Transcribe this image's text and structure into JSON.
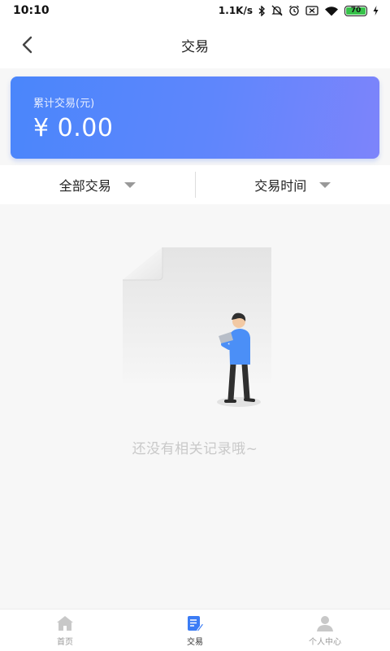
{
  "status_bar": {
    "time": "10:10",
    "network_speed": "1.1K/s",
    "battery_level": "70",
    "icons": [
      "bluetooth-icon",
      "mute-icon",
      "alarm-icon",
      "sim-icon",
      "wifi-icon",
      "battery-icon",
      "charging-icon"
    ]
  },
  "nav": {
    "title": "交易",
    "back_icon": "chevron-left-icon"
  },
  "summary": {
    "label": "累计交易(元)",
    "value": "¥ 0.00"
  },
  "filters": [
    {
      "label": "全部交易",
      "icon": "caret-down-icon"
    },
    {
      "label": "交易时间",
      "icon": "caret-down-icon"
    }
  ],
  "empty_state": {
    "message": "还没有相关记录哦~",
    "illustration": "empty-document-illustration"
  },
  "tab_bar": {
    "items": [
      {
        "label": "首页",
        "icon": "home-icon",
        "active": false
      },
      {
        "label": "交易",
        "icon": "edit-document-icon",
        "active": true
      },
      {
        "label": "个人中心",
        "icon": "user-icon",
        "active": false
      }
    ],
    "active_color": "#3b7cf5",
    "inactive_color": "#c8c8c8"
  },
  "colors": {
    "card_gradient_start": "#4a86fb",
    "card_gradient_end": "#7d84fb",
    "battery_green": "#37c24a"
  }
}
